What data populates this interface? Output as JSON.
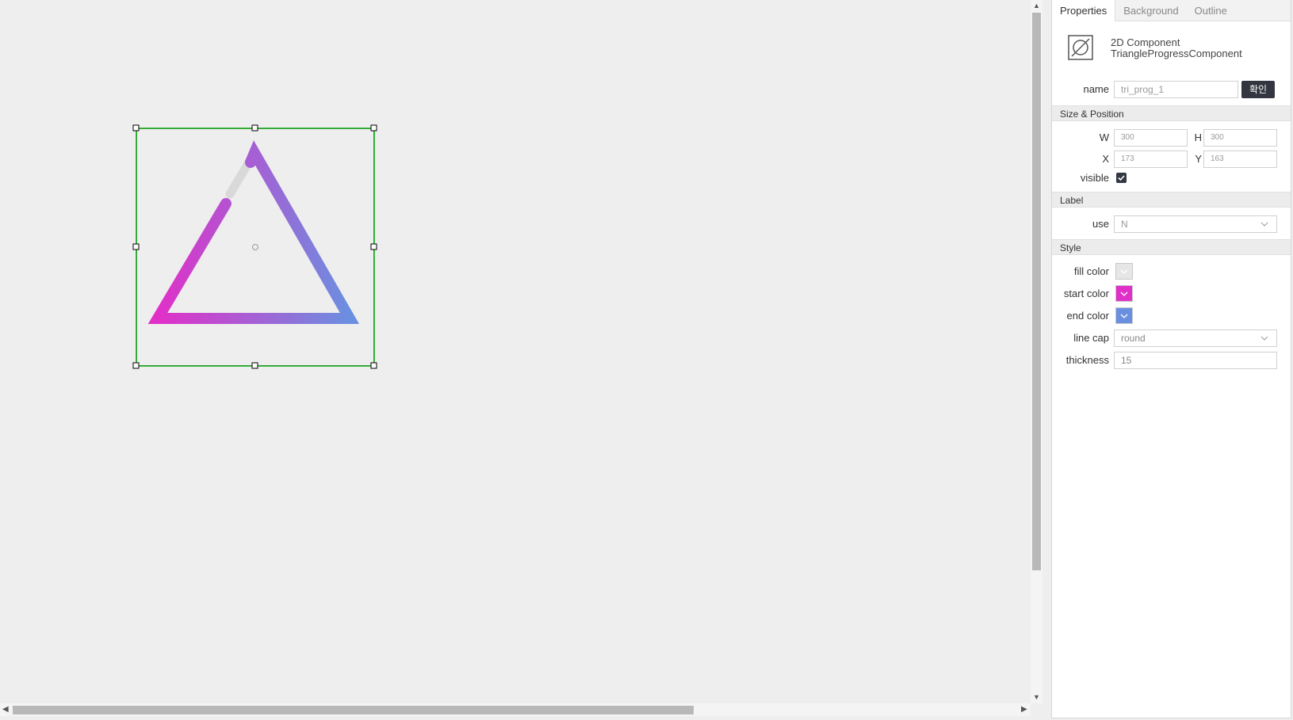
{
  "panel": {
    "tabs": [
      {
        "label": "Properties"
      },
      {
        "label": "Background"
      },
      {
        "label": "Outline"
      }
    ],
    "component": {
      "category": "2D Component",
      "type": "TriangleProgressComponent"
    },
    "name": {
      "label": "name",
      "value": "tri_prog_1",
      "confirm": "확인"
    },
    "size_position": {
      "title": "Size & Position",
      "w_label": "W",
      "w_value": "300",
      "h_label": "H",
      "h_value": "300",
      "x_label": "X",
      "x_value": "173",
      "y_label": "Y",
      "y_value": "163",
      "visible_label": "visible",
      "visible_checked": true
    },
    "label": {
      "title": "Label",
      "use_label": "use",
      "use_value": "N"
    },
    "style": {
      "title": "Style",
      "fill_label": "fill color",
      "fill_color": "#e6e6e6",
      "start_label": "start color",
      "start_color": "#e030c8",
      "end_label": "end color",
      "end_color": "#6b8fe0",
      "linecap_label": "line cap",
      "linecap_value": "round",
      "thickness_label": "thickness",
      "thickness_value": "15"
    }
  },
  "canvas": {
    "selection_color": "#00aa00",
    "track_color": "#d9d9d9",
    "progress_fraction": 0.95
  }
}
